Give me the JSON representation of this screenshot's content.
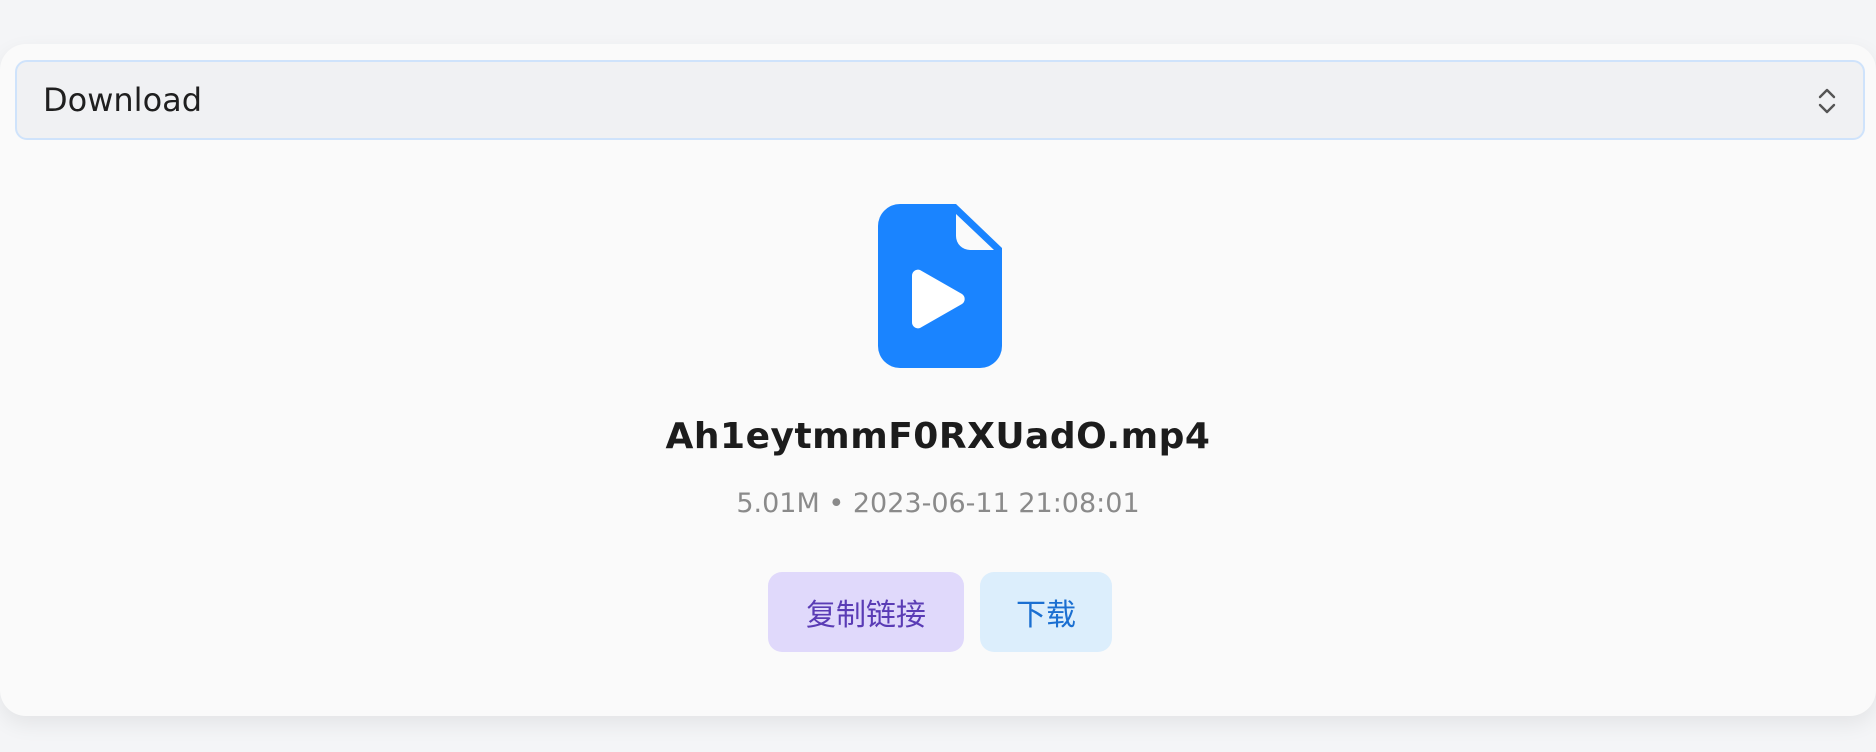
{
  "select": {
    "value": "Download"
  },
  "file": {
    "icon": "video-file-icon",
    "name": "Ah1eytmmF0RXUadO.mp4",
    "size": "5.01M",
    "separator": "•",
    "modified": "2023-06-11 21:08:01",
    "meta": "5.01M • 2023-06-11 21:08:01"
  },
  "actions": {
    "copy_link_label": "复制链接",
    "download_label": "下载"
  },
  "colors": {
    "accent": "#1a84ff",
    "copy_button_bg": "#e0d9fb",
    "download_button_bg": "#dceefc"
  }
}
